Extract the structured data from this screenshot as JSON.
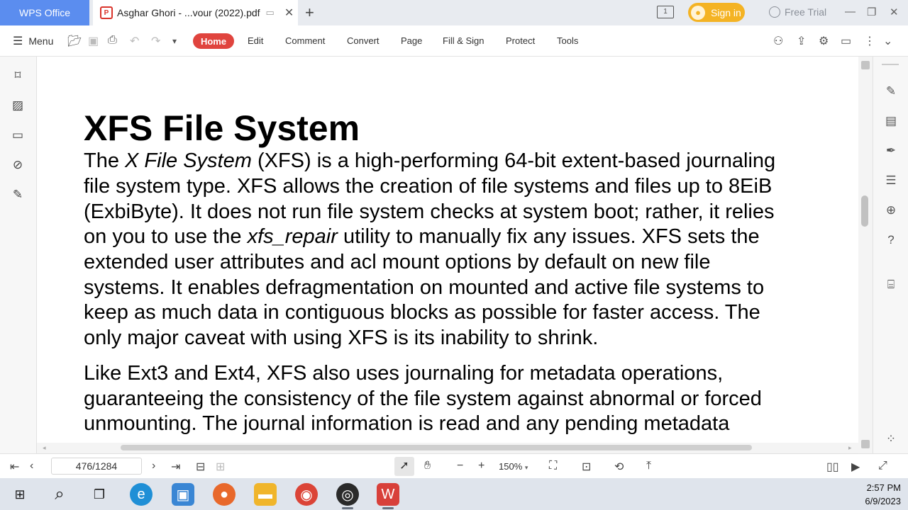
{
  "titlebar": {
    "app_tab": "WPS Office",
    "doc_tab": "Asghar Ghori - ...vour (2022).pdf",
    "sign_in": "Sign in",
    "free_trial": "Free Trial"
  },
  "menu": {
    "menu_label": "Menu",
    "tabs": [
      "Home",
      "Edit",
      "Comment",
      "Convert",
      "Page",
      "Fill & Sign",
      "Protect",
      "Tools"
    ]
  },
  "document": {
    "heading": "XFS File System",
    "para1": {
      "line1_pre": "The ",
      "line1_italic": "X File System",
      "line1_post": " (XFS) is a high-performing 64-bit extent-based journaling",
      "line2": "file system type. XFS allows the creation of file systems and files up to 8EiB",
      "line3": "(ExbiByte). It does not run file system checks at system boot; rather, it relies",
      "line4_pre": "on you to use the ",
      "line4_italic": "xfs_repair",
      "line4_post": " utility to manually fix any issues. XFS sets the",
      "line5": "extended user attributes and acl mount options by default on new file",
      "line6": "systems. It enables defragmentation on mounted and active file systems to",
      "line7": "keep as much data in contiguous blocks as possible for faster access. The",
      "line8": "only major caveat with using XFS is its inability to shrink."
    },
    "para2": {
      "line1": "Like Ext3 and Ext4, XFS also uses journaling for metadata operations,",
      "line2": "guaranteeing the consistency of the file system against abnormal or forced",
      "line3": "unmounting. The journal information is read and any pending metadata"
    }
  },
  "statusbar": {
    "page": "476/1284",
    "zoom": "150%"
  },
  "taskbar": {
    "time": "2:57 PM",
    "date": "6/9/2023"
  },
  "colors": {
    "accent_blue": "#5b8def",
    "home_red": "#e0443e",
    "signin_yellow": "#f4b324"
  }
}
